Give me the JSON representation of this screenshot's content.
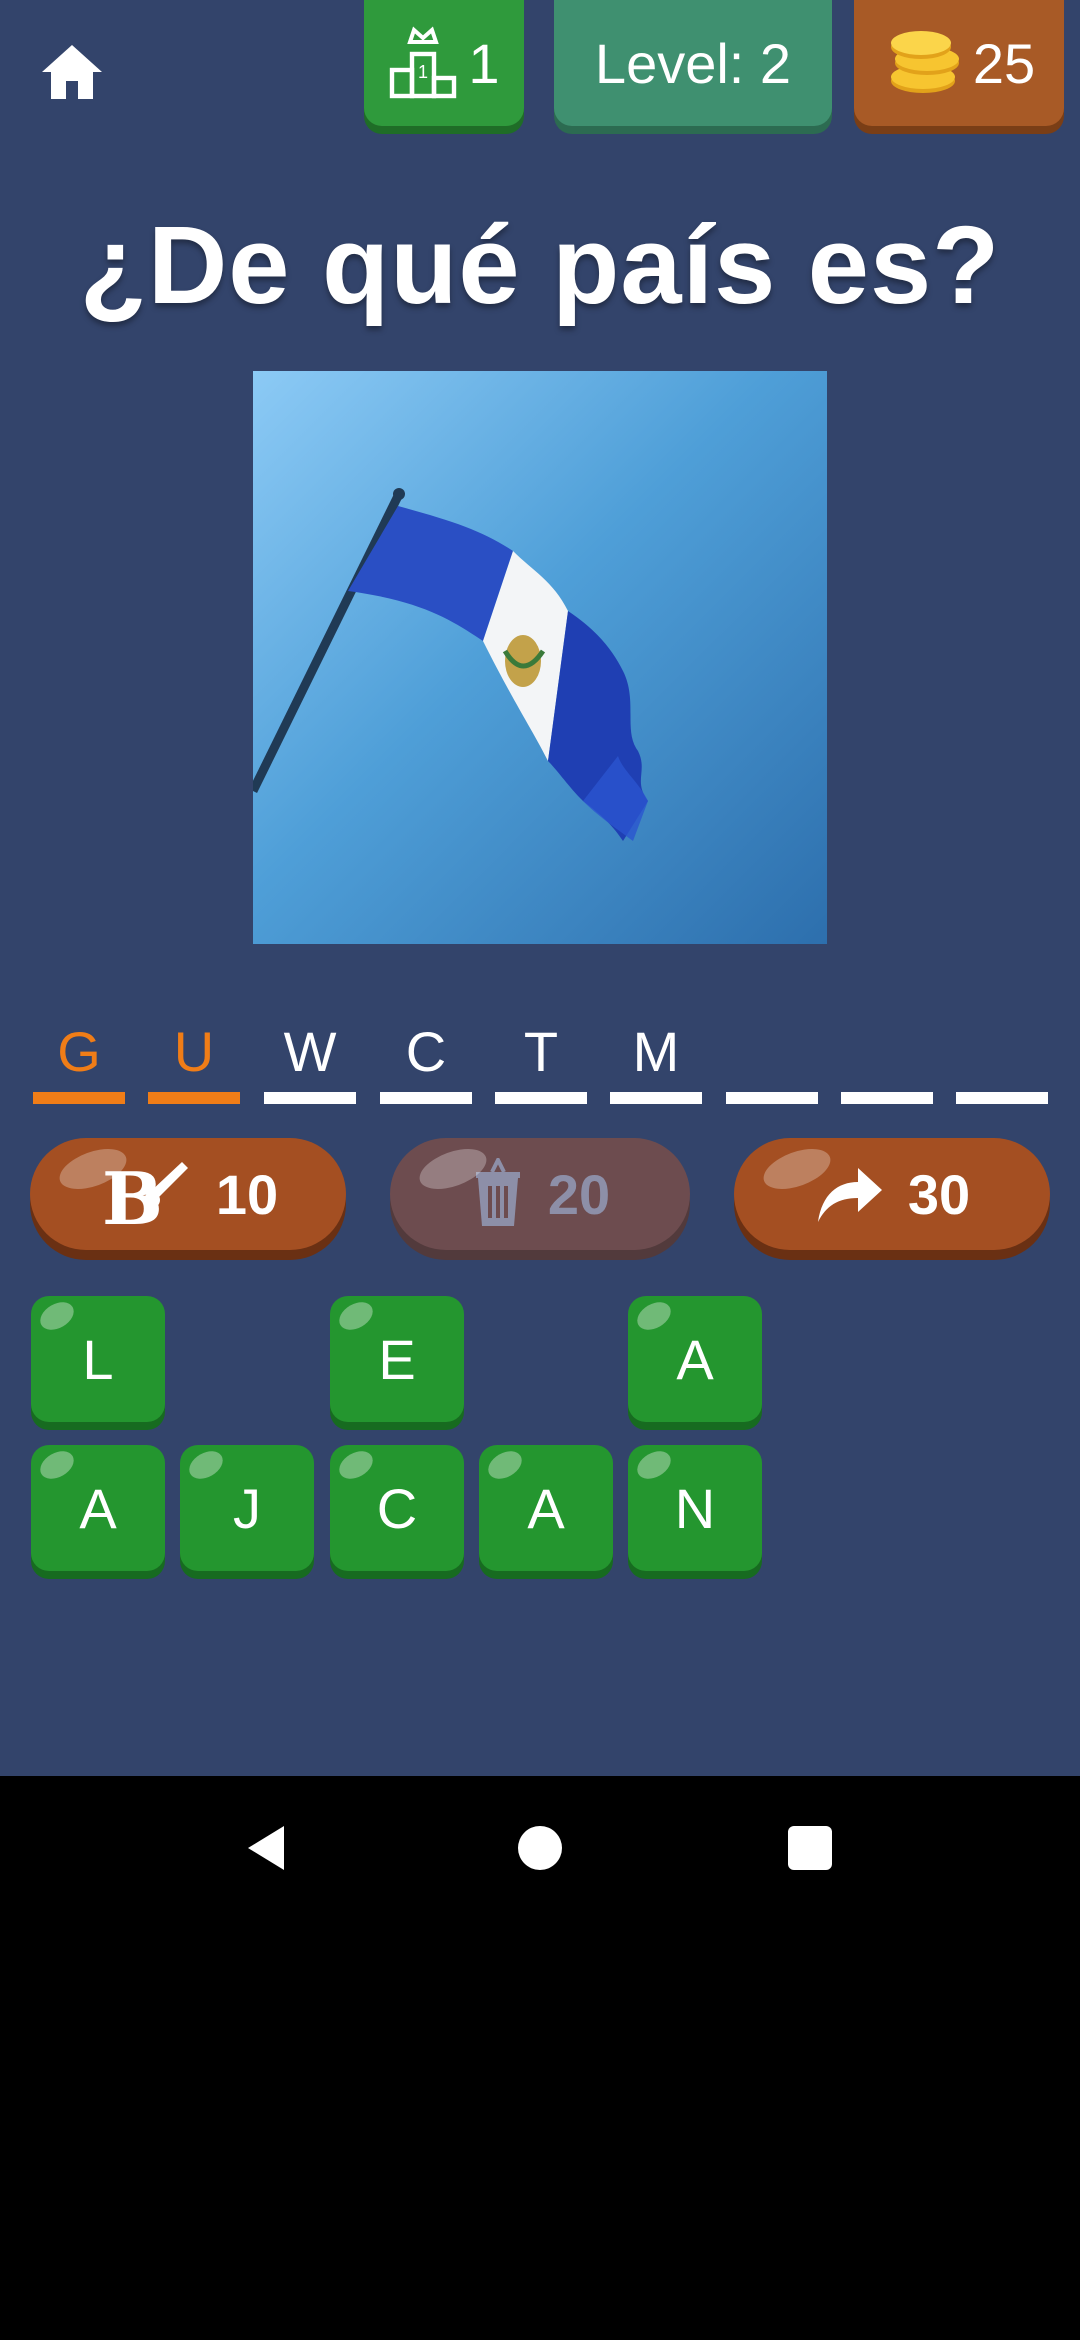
{
  "header": {
    "rank_value": "1",
    "level_text": "Level: 2",
    "coins_value": "25"
  },
  "title": "¿De qué país es?",
  "answer_slots": [
    {
      "char": "G",
      "state": "hint"
    },
    {
      "char": "U",
      "state": "hint"
    },
    {
      "char": "W",
      "state": "filled"
    },
    {
      "char": "C",
      "state": "filled"
    },
    {
      "char": "T",
      "state": "filled"
    },
    {
      "char": "M",
      "state": "filled"
    },
    {
      "char": "",
      "state": "empty"
    },
    {
      "char": "",
      "state": "empty"
    },
    {
      "char": "",
      "state": "empty"
    }
  ],
  "powerups": {
    "brush_cost": "10",
    "brush_icon_letter": "B",
    "trash_cost": "20",
    "skip_cost": "30"
  },
  "letter_tiles": {
    "row1": [
      "L",
      "",
      "E",
      "",
      "A"
    ],
    "row2": [
      "A",
      "J",
      "C",
      "A",
      "N"
    ]
  },
  "colors": {
    "background": "#33446b",
    "hint_orange": "#f07d17",
    "tile_green": "#24962f",
    "powerup_brown": "#a44f22"
  },
  "icons": [
    "home-icon",
    "podium-crown-icon",
    "coins-icon",
    "paintbrush-icon",
    "trash-icon",
    "share-arrow-icon",
    "back-icon",
    "home-circle-icon",
    "recents-icon"
  ]
}
